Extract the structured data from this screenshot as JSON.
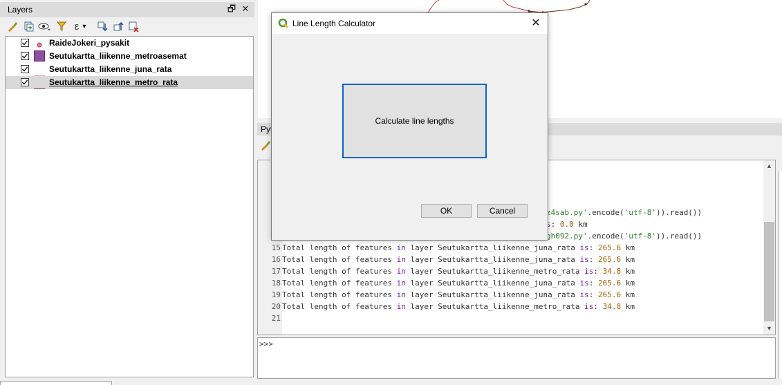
{
  "layers_panel": {
    "title": "Layers",
    "float_symbol": "🗗",
    "close_symbol": "✕",
    "toolbar": [
      "style-brush-icon",
      "add-group-icon",
      "visibility-eye-icon",
      "filter-icon",
      "expression-filter-icon",
      "expand-all-icon",
      "collapse-all-icon",
      "remove-layer-icon"
    ],
    "expression_symbol": "ε",
    "dropdown_symbol": "▾",
    "items": [
      {
        "label": "RaideJokeri_pysakit",
        "checked": true,
        "symbol": "point",
        "color": "#e87a8a"
      },
      {
        "label": "Seutukartta_liikenne_metroasemat",
        "checked": true,
        "symbol": "polygon",
        "color": "#8e4f9e"
      },
      {
        "label": "Seutukartta_liikenne_juna_rata",
        "checked": true,
        "symbol": "line",
        "color": "#e6a0b4"
      },
      {
        "label": "Seutukartta_liikenne_metro_rata",
        "checked": true,
        "symbol": "line",
        "color": "#8a3a3a",
        "selected": true
      }
    ]
  },
  "python_console": {
    "header_label": "Pyt",
    "prompt": ">>>",
    "lines": [
      {
        "n": "",
        "segments": [
          {
            "t": "z4sab.py'",
            "c": "str"
          },
          {
            "t": ".encode(",
            "c": ""
          },
          {
            "t": "'utf-8'",
            "c": "str"
          },
          {
            "t": ")).read())",
            "c": ""
          }
        ]
      },
      {
        "n": "",
        "segments": [
          {
            "t": "s",
            "c": "kw"
          },
          {
            "t": ": ",
            "c": ""
          },
          {
            "t": "0.0",
            "c": "num"
          },
          {
            "t": " km",
            "c": ""
          }
        ]
      },
      {
        "n": "",
        "segments": [
          {
            "t": "gh092.py'",
            "c": "str"
          },
          {
            "t": ".encode(",
            "c": ""
          },
          {
            "t": "'utf-8'",
            "c": "str"
          },
          {
            "t": ")).read())",
            "c": ""
          }
        ]
      },
      {
        "n": "15",
        "segments": [
          {
            "t": "Total length of features ",
            "c": ""
          },
          {
            "t": "in",
            "c": "kw"
          },
          {
            "t": " layer Seutukartta_liikenne_juna_rata ",
            "c": ""
          },
          {
            "t": "is",
            "c": "kw"
          },
          {
            "t": ": ",
            "c": ""
          },
          {
            "t": "265.6",
            "c": "num"
          },
          {
            "t": " km",
            "c": ""
          }
        ]
      },
      {
        "n": "16",
        "segments": [
          {
            "t": "Total length of features ",
            "c": ""
          },
          {
            "t": "in",
            "c": "kw"
          },
          {
            "t": " layer Seutukartta_liikenne_juna_rata ",
            "c": ""
          },
          {
            "t": "is",
            "c": "kw"
          },
          {
            "t": ": ",
            "c": ""
          },
          {
            "t": "265.6",
            "c": "num"
          },
          {
            "t": " km",
            "c": ""
          }
        ]
      },
      {
        "n": "17",
        "segments": [
          {
            "t": "Total length of features ",
            "c": ""
          },
          {
            "t": "in",
            "c": "kw"
          },
          {
            "t": " layer Seutukartta_liikenne_metro_rata ",
            "c": ""
          },
          {
            "t": "is",
            "c": "kw"
          },
          {
            "t": ": ",
            "c": ""
          },
          {
            "t": "34.8",
            "c": "num"
          },
          {
            "t": " km",
            "c": ""
          }
        ]
      },
      {
        "n": "18",
        "segments": [
          {
            "t": "Total length of features ",
            "c": ""
          },
          {
            "t": "in",
            "c": "kw"
          },
          {
            "t": " layer Seutukartta_liikenne_juna_rata ",
            "c": ""
          },
          {
            "t": "is",
            "c": "kw"
          },
          {
            "t": ": ",
            "c": ""
          },
          {
            "t": "265.6",
            "c": "num"
          },
          {
            "t": " km",
            "c": ""
          }
        ]
      },
      {
        "n": "19",
        "segments": [
          {
            "t": "Total length of features ",
            "c": ""
          },
          {
            "t": "in",
            "c": "kw"
          },
          {
            "t": " layer Seutukartta_liikenne_juna_rata ",
            "c": ""
          },
          {
            "t": "is",
            "c": "kw"
          },
          {
            "t": ": ",
            "c": ""
          },
          {
            "t": "265.6",
            "c": "num"
          },
          {
            "t": " km",
            "c": ""
          }
        ]
      },
      {
        "n": "20",
        "segments": [
          {
            "t": "Total length of features ",
            "c": ""
          },
          {
            "t": "in",
            "c": "kw"
          },
          {
            "t": " layer Seutukartta_liikenne_metro_rata ",
            "c": ""
          },
          {
            "t": "is",
            "c": "kw"
          },
          {
            "t": ": ",
            "c": ""
          },
          {
            "t": "34.8",
            "c": "num"
          },
          {
            "t": " km",
            "c": ""
          }
        ]
      },
      {
        "n": "21",
        "segments": []
      }
    ],
    "scroll_up_symbol": "▲",
    "scroll_down_symbol": "▼"
  },
  "dialog": {
    "title": "Line Length Calculator",
    "close_symbol": "✕",
    "calculate_label": "Calculate line lengths",
    "ok_label": "OK",
    "cancel_label": "Cancel"
  },
  "colors": {
    "focus_blue": "#0a64c8",
    "qgis_green": "#589632",
    "map_line": "#c83c3c"
  }
}
